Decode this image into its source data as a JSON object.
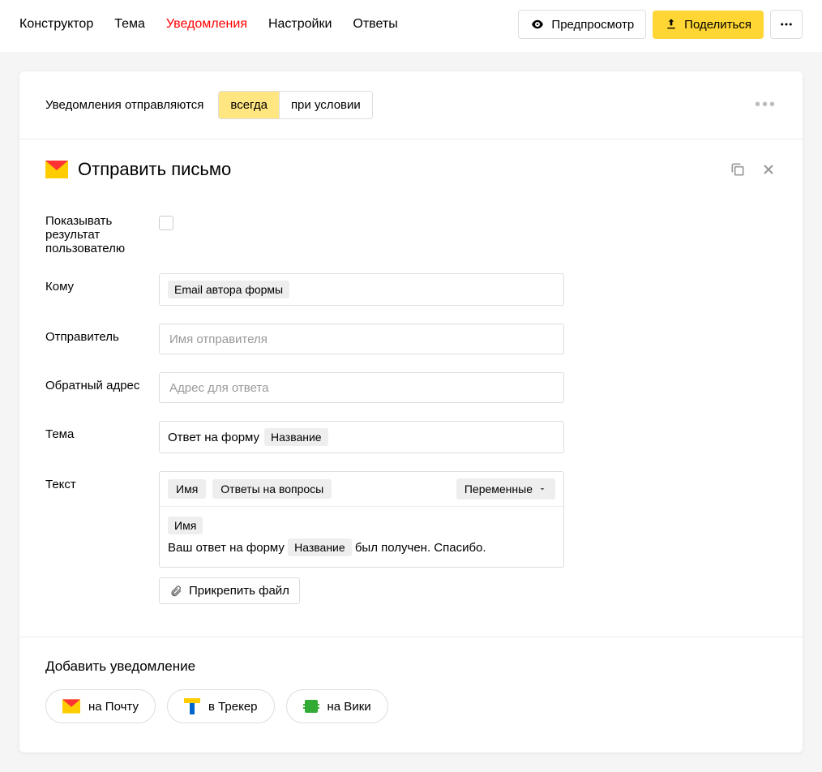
{
  "nav": {
    "tabs": [
      "Конструктор",
      "Тема",
      "Уведомления",
      "Настройки",
      "Ответы"
    ],
    "active_index": 2,
    "preview": "Предпросмотр",
    "share": "Поделиться"
  },
  "condition": {
    "label": "Уведомления отправляются",
    "options": [
      "всегда",
      "при условии"
    ],
    "active_index": 0
  },
  "action": {
    "title": "Отправить письмо"
  },
  "fields": {
    "show_result_label": "Показывать результат пользователю",
    "to": {
      "label": "Кому",
      "chip": "Email автора формы"
    },
    "sender": {
      "label": "Отправитель",
      "placeholder": "Имя отправителя"
    },
    "reply": {
      "label": "Обратный адрес",
      "placeholder": "Адрес для ответа"
    },
    "subject": {
      "label": "Тема",
      "text": "Ответ на форму",
      "chip": "Название"
    },
    "body": {
      "label": "Текст",
      "toolbar_chip1": "Имя",
      "toolbar_chip2": "Ответы на вопросы",
      "vars": "Переменные",
      "line1_chip": "Имя",
      "line2_before": "Ваш ответ на форму",
      "line2_chip": "Название",
      "line2_after": "был получен. Спасибо."
    },
    "attach": "Прикрепить файл"
  },
  "add": {
    "title": "Добавить уведомление",
    "mail": "на Почту",
    "tracker": "в Трекер",
    "wiki": "на Вики"
  }
}
